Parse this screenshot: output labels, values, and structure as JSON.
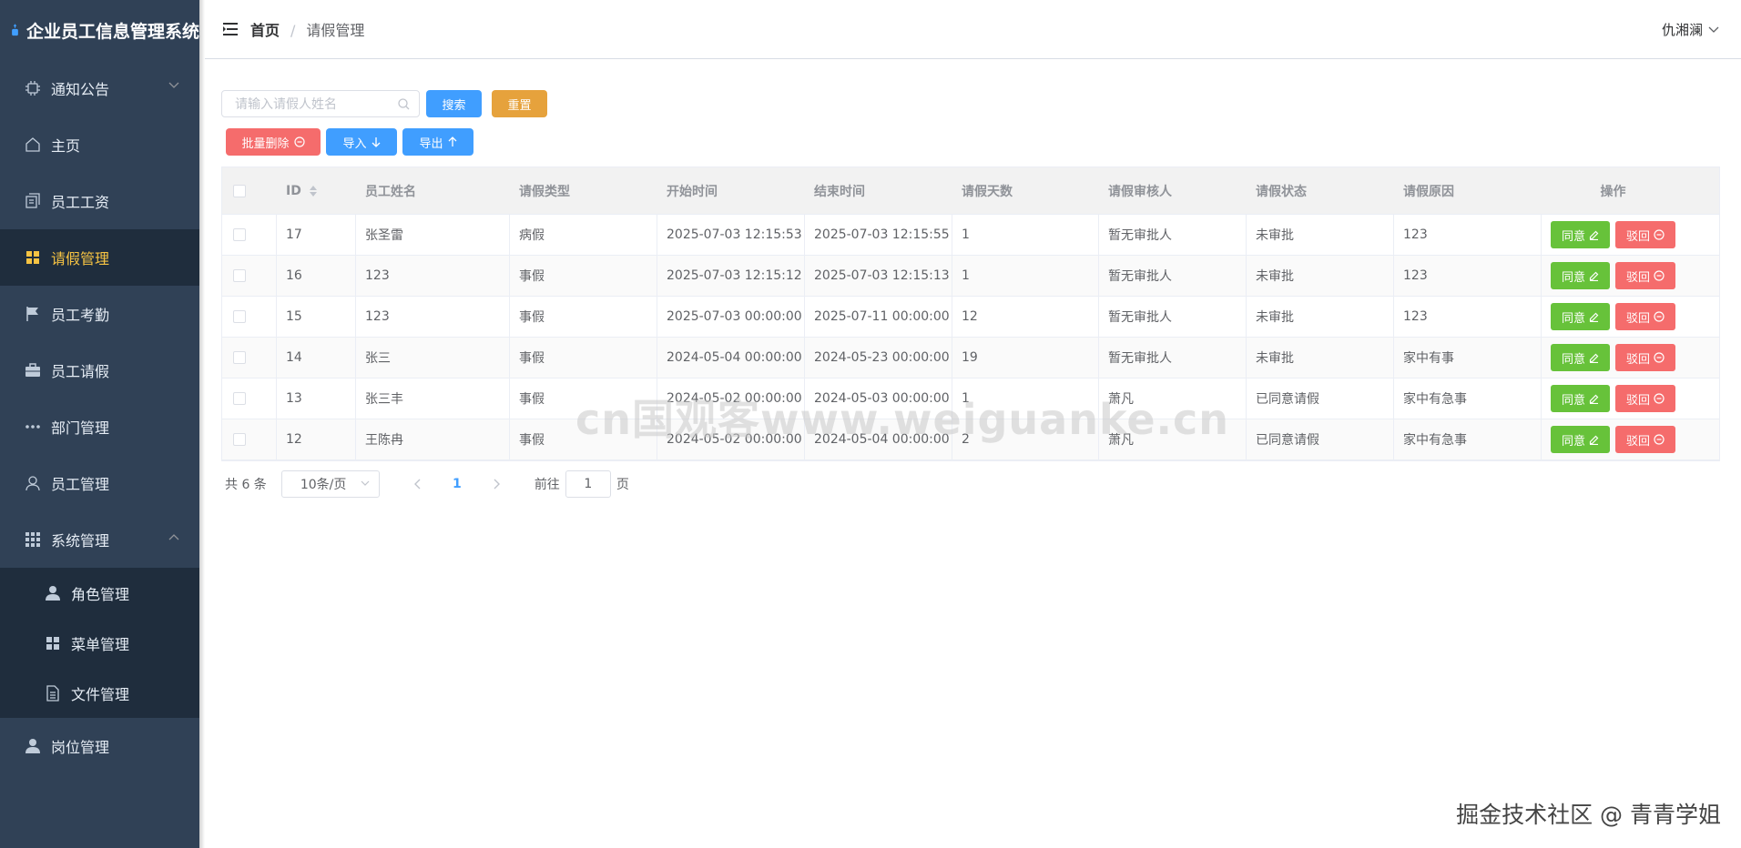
{
  "app": {
    "title": "企业员工信息管理系统"
  },
  "sidebar": {
    "items": [
      {
        "label": "通知公告",
        "icon": "cpu-icon"
      },
      {
        "label": "主页",
        "icon": "home-icon"
      },
      {
        "label": "员工工资",
        "icon": "document-copy-icon"
      },
      {
        "label": "请假管理",
        "icon": "grid-icon",
        "active": true
      },
      {
        "label": "员工考勤",
        "icon": "flag-icon"
      },
      {
        "label": "员工请假",
        "icon": "suitcase-icon"
      },
      {
        "label": "部门管理",
        "icon": "more-icon"
      },
      {
        "label": "员工管理",
        "icon": "user-icon"
      },
      {
        "label": "系统管理",
        "icon": "apps-icon"
      }
    ],
    "sub_items": [
      {
        "label": "角色管理",
        "icon": "user-solid-icon"
      },
      {
        "label": "菜单管理",
        "icon": "menu-grid-icon"
      },
      {
        "label": "文件管理",
        "icon": "file-icon"
      }
    ],
    "last_item": {
      "label": "岗位管理",
      "icon": "user-solid-icon"
    }
  },
  "header": {
    "breadcrumb": {
      "home": "首页",
      "separator": "/",
      "current": "请假管理"
    },
    "user": "仇湘澜"
  },
  "toolbar": {
    "search_placeholder": "请输入请假人姓名",
    "search_label": "搜索",
    "reset_label": "重置",
    "batch_delete_label": "批量删除",
    "import_label": "导入",
    "export_label": "导出"
  },
  "table": {
    "headers": [
      "ID",
      "员工姓名",
      "请假类型",
      "开始时间",
      "结束时间",
      "请假天数",
      "请假审核人",
      "请假状态",
      "请假原因",
      "操作"
    ],
    "rows": [
      {
        "id": "17",
        "name": "张圣雷",
        "type": "病假",
        "start": "2025-07-03 12:15:53",
        "end": "2025-07-03 12:15:55",
        "days": "1",
        "approver": "暂无审批人",
        "status": "未审批",
        "reason": "123"
      },
      {
        "id": "16",
        "name": "123",
        "type": "事假",
        "start": "2025-07-03 12:15:12",
        "end": "2025-07-03 12:15:13",
        "days": "1",
        "approver": "暂无审批人",
        "status": "未审批",
        "reason": "123"
      },
      {
        "id": "15",
        "name": "123",
        "type": "事假",
        "start": "2025-07-03 00:00:00",
        "end": "2025-07-11 00:00:00",
        "days": "12",
        "approver": "暂无审批人",
        "status": "未审批",
        "reason": "123"
      },
      {
        "id": "14",
        "name": "张三",
        "type": "事假",
        "start": "2024-05-04 00:00:00",
        "end": "2024-05-23 00:00:00",
        "days": "19",
        "approver": "暂无审批人",
        "status": "未审批",
        "reason": "家中有事"
      },
      {
        "id": "13",
        "name": "张三丰",
        "type": "事假",
        "start": "2024-05-02 00:00:00",
        "end": "2024-05-03 00:00:00",
        "days": "1",
        "approver": "萧凡",
        "status": "已同意请假",
        "reason": "家中有急事"
      },
      {
        "id": "12",
        "name": "王陈冉",
        "type": "事假",
        "start": "2024-05-02 00:00:00",
        "end": "2024-05-04 00:00:00",
        "days": "2",
        "approver": "萧凡",
        "status": "已同意请假",
        "reason": "家中有急事"
      }
    ],
    "approve_label": "同意",
    "reject_label": "驳回"
  },
  "pagination": {
    "total": "共 6 条",
    "page_size": "10条/页",
    "current_page": "1",
    "goto_label": "前往",
    "goto_value": "1",
    "page_unit": "页"
  },
  "watermarks": {
    "center": "cn国观客www.weiguanke.cn",
    "corner": "掘金技术社区 @ 青青学姐"
  },
  "colors": {
    "sidebar_bg": "#304156",
    "sidebar_active_text": "#f6c343",
    "primary": "#409eff",
    "warning": "#e6a23c",
    "danger": "#f56c6c",
    "success": "#67c23a"
  }
}
